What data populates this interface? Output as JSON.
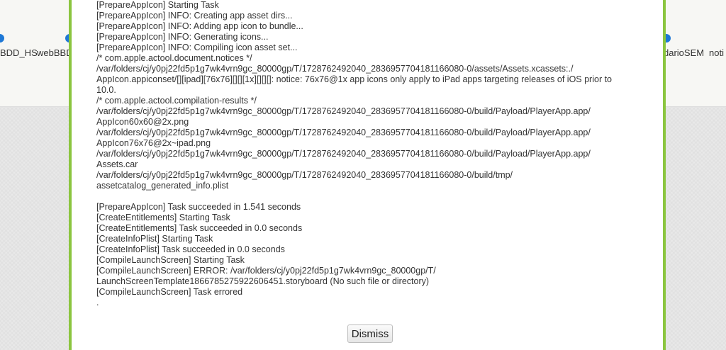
{
  "background": {
    "toolbar_items": [
      "BDD_HS",
      "webBBD",
      "darioSEM",
      "noti"
    ]
  },
  "dialog": {
    "accent_color": "#8bc53f",
    "log_lines": [
      "[PrepareAppIcon] Starting Task",
      "[PrepareAppIcon] INFO: Creating app asset dirs...",
      "[PrepareAppIcon] INFO: Adding app icon to bundle...",
      "[PrepareAppIcon] INFO: Generating icons...",
      "[PrepareAppIcon] INFO: Compiling icon asset set...",
      "/* com.apple.actool.document.notices */",
      "/var/folders/cj/y0pj22fd5p1g7wk4vrn9gc_80000gp/T/1728762492040_2836957704181166080-0/assets/Assets.xcassets:./",
      "AppIcon.appiconset/[][ipad][76x76][][][1x][][][]: notice: 76x76@1x app icons only apply to iPad apps targeting releases of iOS prior to",
      "10.0.",
      "/* com.apple.actool.compilation-results */",
      "/var/folders/cj/y0pj22fd5p1g7wk4vrn9gc_80000gp/T/1728762492040_2836957704181166080-0/build/Payload/PlayerApp.app/",
      "AppIcon60x60@2x.png",
      "/var/folders/cj/y0pj22fd5p1g7wk4vrn9gc_80000gp/T/1728762492040_2836957704181166080-0/build/Payload/PlayerApp.app/",
      "AppIcon76x76@2x~ipad.png",
      "/var/folders/cj/y0pj22fd5p1g7wk4vrn9gc_80000gp/T/1728762492040_2836957704181166080-0/build/Payload/PlayerApp.app/",
      "Assets.car",
      "/var/folders/cj/y0pj22fd5p1g7wk4vrn9gc_80000gp/T/1728762492040_2836957704181166080-0/build/tmp/",
      "assetcatalog_generated_info.plist",
      "",
      "[PrepareAppIcon] Task succeeded in 1.541 seconds",
      "[CreateEntitlements] Starting Task",
      "[CreateEntitlements] Task succeeded in 0.0 seconds",
      "[CreateInfoPlist] Starting Task",
      "[CreateInfoPlist] Task succeeded in 0.0 seconds",
      "[CompileLaunchScreen] Starting Task",
      "[CompileLaunchScreen] ERROR: /var/folders/cj/y0pj22fd5p1g7wk4vrn9gc_80000gp/T/",
      "LaunchScreenTemplate1866785275922606451.storyboard (No such file or directory)",
      "[CompileLaunchScreen] Task errored",
      "."
    ],
    "dismiss_label": "Dismiss"
  }
}
